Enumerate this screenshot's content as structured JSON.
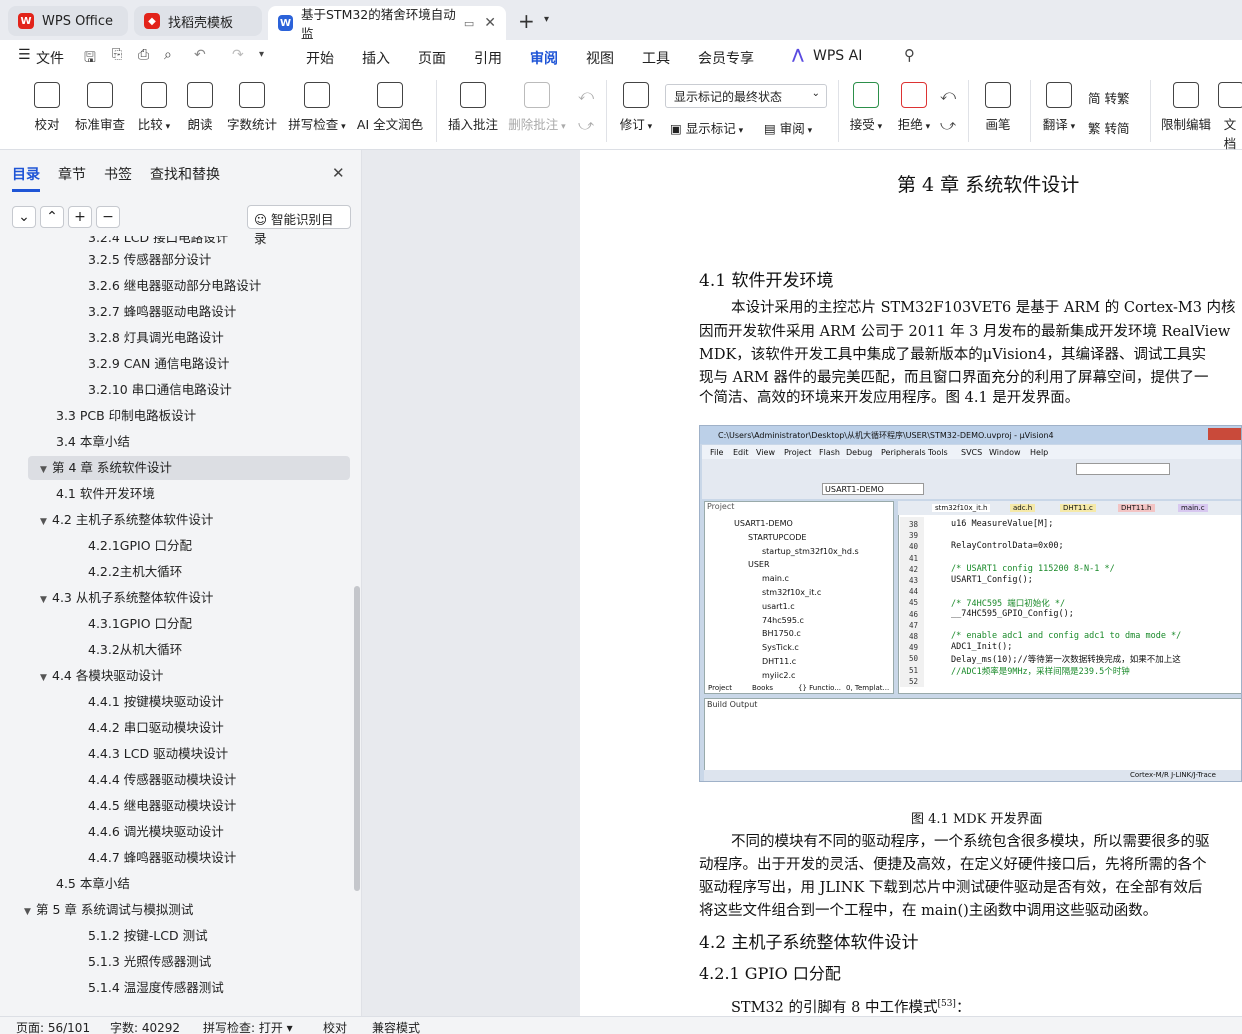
{
  "tabs": [
    {
      "label": "WPS Office",
      "icon": "wps-logo-icon"
    },
    {
      "label": "找稻壳模板",
      "icon": "docer-icon"
    },
    {
      "label": "基于STM32的猪舍环境自动监",
      "icon": "writer-doc-icon"
    }
  ],
  "menu": {
    "file": "文件",
    "items": [
      "开始",
      "插入",
      "页面",
      "引用",
      "审阅",
      "视图",
      "工具",
      "会员专享"
    ],
    "selected": "审阅",
    "ai": "WPS AI"
  },
  "ribbon": {
    "proofread": "校对",
    "std_review": "标准审查",
    "compare": "比较",
    "read_aloud": "朗读",
    "word_count": "字数统计",
    "spell_check": "拼写检查",
    "ai_polish": "AI 全文润色",
    "insert_comment": "插入批注",
    "delete_comment": "删除批注",
    "track_changes": "修订",
    "show_markup_dd": "显示标记的最终状态",
    "show_markup": "显示标记",
    "review": "审阅",
    "accept": "接受",
    "reject": "拒绝",
    "pen": "画笔",
    "translate": "翻译",
    "to_traditional": "转繁",
    "to_simplified": "转简",
    "restrict_edit": "限制编辑",
    "doc_more": "文档"
  },
  "nav": {
    "tabs": [
      "目录",
      "章节",
      "书签",
      "查找和替换"
    ],
    "selected_tab": "目录",
    "smart_btn": "智能识别目录",
    "items": [
      {
        "label": "3.2.4 LCD 接口电路设计",
        "level": 3
      },
      {
        "label": "3.2.5 传感器部分设计",
        "level": 3
      },
      {
        "label": "3.2.6 继电器驱动部分电路设计",
        "level": 3
      },
      {
        "label": "3.2.7 蜂鸣器驱动电路设计",
        "level": 3
      },
      {
        "label": "3.2.8 灯具调光电路设计",
        "level": 3
      },
      {
        "label": "3.2.9 CAN 通信电路设计",
        "level": 3
      },
      {
        "label": "3.2.10 串口通信电路设计",
        "level": 3
      },
      {
        "label": "3.3 PCB 印制电路板设计",
        "level": 2
      },
      {
        "label": "3.4  本章小结",
        "level": 2
      },
      {
        "label": "第 4 章  系统软件设计",
        "level": 1,
        "caret": true,
        "selected": true
      },
      {
        "label": "4.1  软件开发环境",
        "level": 2
      },
      {
        "label": "4.2  主机子系统整体软件设计",
        "level": 2,
        "caret": true
      },
      {
        "label": "4.2.1GPIO 口分配",
        "level": 3
      },
      {
        "label": "4.2.2主机大循环",
        "level": 3
      },
      {
        "label": "4.3  从机子系统整体软件设计",
        "level": 2,
        "caret": true
      },
      {
        "label": "4.3.1GPIO 口分配",
        "level": 3
      },
      {
        "label": "4.3.2从机大循环",
        "level": 3
      },
      {
        "label": "4.4  各模块驱动设计",
        "level": 2,
        "caret": true
      },
      {
        "label": "4.4.1 按键模块驱动设计",
        "level": 3
      },
      {
        "label": "4.4.2 串口驱动模块设计",
        "level": 3
      },
      {
        "label": "4.4.3 LCD 驱动模块设计",
        "level": 3
      },
      {
        "label": "4.4.4 传感器驱动模块设计",
        "level": 3
      },
      {
        "label": "4.4.5 继电器驱动模块设计",
        "level": 3
      },
      {
        "label": "4.4.6 调光模块驱动设计",
        "level": 3
      },
      {
        "label": "4.4.7 蜂鸣器驱动模块设计",
        "level": 3
      },
      {
        "label": "4.5  本章小结",
        "level": 2
      },
      {
        "label": "第 5 章  系统调试与模拟测试",
        "level": 1,
        "caret": true
      },
      {
        "label": "5.1.2 按键-LCD 测试",
        "level": 3
      },
      {
        "label": "5.1.3 光照传感器测试",
        "level": 3
      },
      {
        "label": "5.1.4 温湿度传感器测试",
        "level": 3
      }
    ]
  },
  "doc": {
    "chapter": "第 4 章  系统软件设计",
    "h41": "4.1  软件开发环境",
    "p1": [
      "本设计采用的主控芯片 STM32F103VET6 是基于 ARM 的 Cortex-M3 内核",
      "因而开发软件采用 ARM 公司于 2011 年 3 月发布的最新集成开发环境 RealView",
      "MDK，该软件开发工具中集成了最新版本的μVision4，其编译器、调试工具实",
      "现与 ARM 器件的最完美匹配，而且窗口界面充分的利用了屏幕空间，提供了一",
      "个简洁、高效的环境来开发应用程序。图 4.1 是开发界面。"
    ],
    "caption": "图 4.1 MDK 开发界面",
    "p2": [
      "不同的模块有不同的驱动程序，一个系统包含很多模块，所以需要很多的驱",
      "动程序。出于开发的灵活、便捷及高效，在定义好硬件接口后，先将所需的各个",
      "驱动程序写出，用 JLINK 下载到芯片中测试硬件驱动是否有效，在全部有效后",
      "将这些文件组合到一个工程中，在 main()主函数中调用这些驱动函数。"
    ],
    "h42": "4.2  主机子系统整体软件设计",
    "h421": "4.2.1 GPIO 口分配",
    "p3": "STM32 的引脚有 8 中工作模式",
    "p3_sup": "[53]",
    "p3_end": "："
  },
  "mdk": {
    "title": "C:\\Users\\Administrator\\Desktop\\从机大循环程序\\USER\\STM32-DEMO.uvproj - µVision4",
    "menus": [
      "File",
      "Edit",
      "View",
      "Project",
      "Flash",
      "Debug",
      "Peripherals",
      "Tools",
      "SVCS",
      "Window",
      "Help"
    ],
    "target": "USART1-DEMO",
    "project_label": "Project",
    "tree": [
      "USART1-DEMO",
      "STARTUPCODE",
      "startup_stm32f10x_hd.s",
      "USER",
      "main.c",
      "stm32f10x_it.c",
      "usart1.c",
      "74hc595.c",
      "BH1750.c",
      "SysTick.c",
      "DHT11.c",
      "myiic2.c"
    ],
    "file_tabs": [
      "stm32f10x_it.h",
      "adc.h",
      "DHT11.c",
      "DHT11.h",
      "main.c"
    ],
    "line_nums": [
      "38",
      "39",
      "40",
      "41",
      "42",
      "43",
      "44",
      "45",
      "46",
      "47",
      "48",
      "49",
      "50",
      "51",
      "52"
    ],
    "code": [
      "u16 MeasureValue[M];",
      "",
      "RelayControlData=0x00;",
      "",
      "/* USART1 config 115200 8-N-1 */",
      "USART1_Config();",
      "",
      "/* 74HC595 端口初始化 */",
      "__74HC595_GPIO_Config();",
      "",
      "/* enable adc1 and config adc1 to dma mode */",
      "ADC1_Init();",
      "Delay_ms(10);//等待第一次数据转换完成，如果不加上这",
      "             //ADC1频率是9MHz，采样间隔是239.5个时钟",
      ""
    ],
    "bottom_tabs": [
      "Project",
      "Books",
      "{} Functio...",
      "0, Templat..."
    ],
    "build_output": "Build Output",
    "status_right": "Cortex-M/R J-LINK/J-Trace"
  },
  "status": {
    "page": "页面: 56/101",
    "words": "字数: 40292",
    "spell": "拼写检查: 打开",
    "proof": "校对",
    "compat": "兼容模式"
  }
}
